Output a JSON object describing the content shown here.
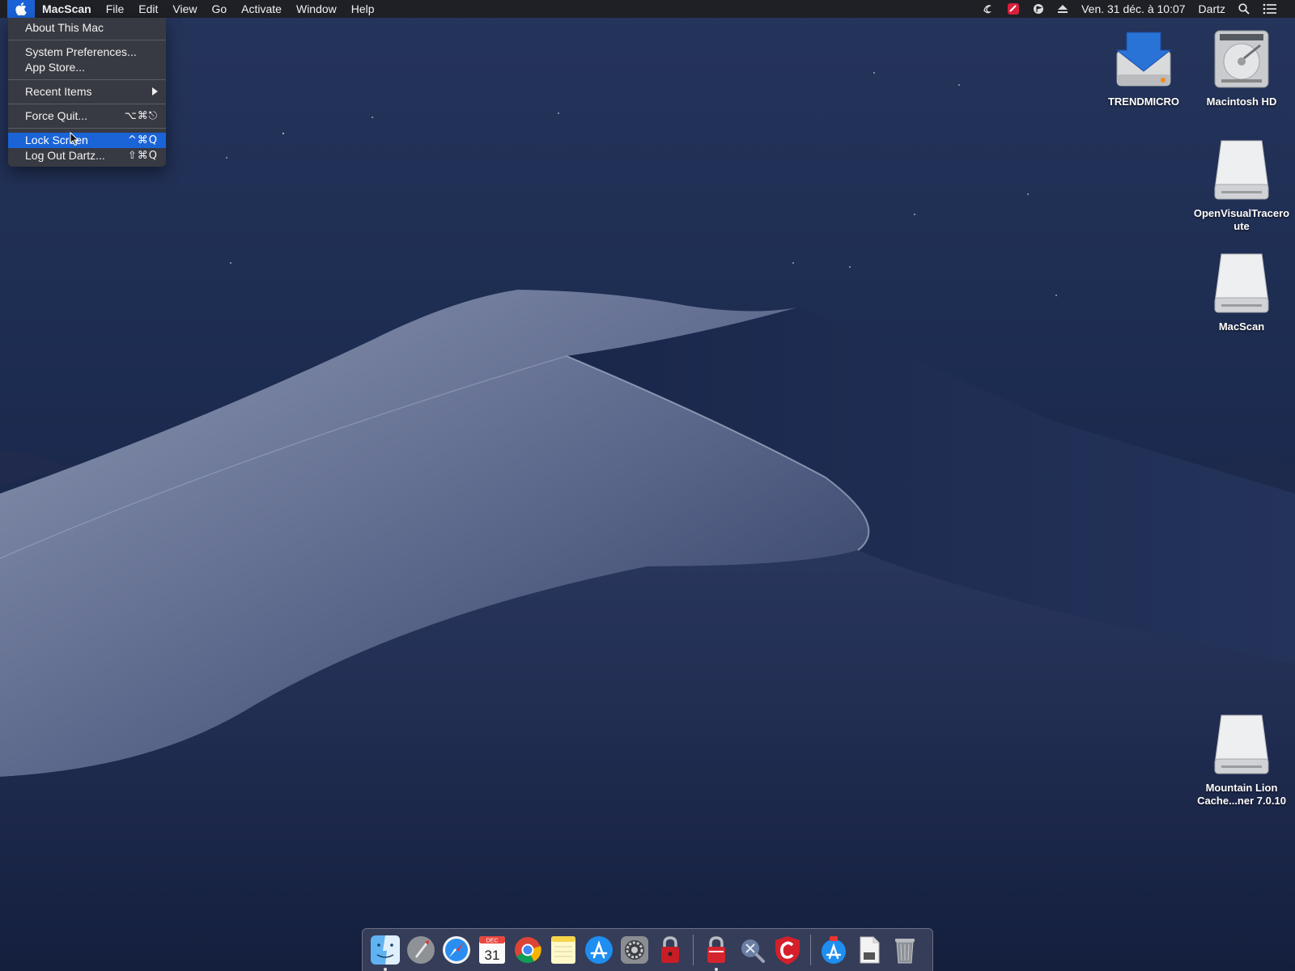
{
  "menubar": {
    "app_name": "MacScan",
    "menus": [
      "File",
      "Edit",
      "View",
      "Go",
      "Activate",
      "Window",
      "Help"
    ],
    "clock": "Ven. 31 déc. à 10:07",
    "user": "Dartz"
  },
  "apple_menu": {
    "about": "About This Mac",
    "system_preferences": "System Preferences...",
    "app_store": "App Store...",
    "recent_items": "Recent Items",
    "force_quit": "Force Quit...",
    "force_quit_shortcut": "⌥⌘⎋",
    "lock_screen": "Lock Screen",
    "lock_screen_shortcut": "^⌘Q",
    "log_out": "Log Out Dartz...",
    "log_out_shortcut": "⇧⌘Q",
    "highlighted_item": "Lock Screen"
  },
  "desktop": {
    "icons": [
      {
        "label": "TRENDMICRO",
        "icon": "installer-disk-icon"
      },
      {
        "label": "Macintosh HD",
        "icon": "hard-drive-icon"
      },
      {
        "label": "OpenVisualTraceroute",
        "icon": "disk-image-icon"
      },
      {
        "label": "MacScan",
        "icon": "disk-image-icon"
      },
      {
        "label": "Mountain Lion Cache...ner 7.0.10",
        "icon": "disk-image-icon"
      }
    ]
  },
  "dock": {
    "calendar_day": "31",
    "calendar_month": "DEC",
    "items": [
      "finder-icon",
      "launchpad-icon",
      "safari-icon",
      "calendar-icon",
      "chrome-icon",
      "notes-icon",
      "app-store-icon",
      "system-preferences-icon",
      "lock-app-icon",
      "macscan-icon",
      "utility-icon",
      "c-shield-icon",
      "app-store-downloads-icon",
      "document-icon",
      "trash-icon"
    ]
  },
  "colors": {
    "menu_highlight": "#1a64d8",
    "menubar_bg": "#1e1e22",
    "wallpaper_sky": "#1a2a4d"
  }
}
